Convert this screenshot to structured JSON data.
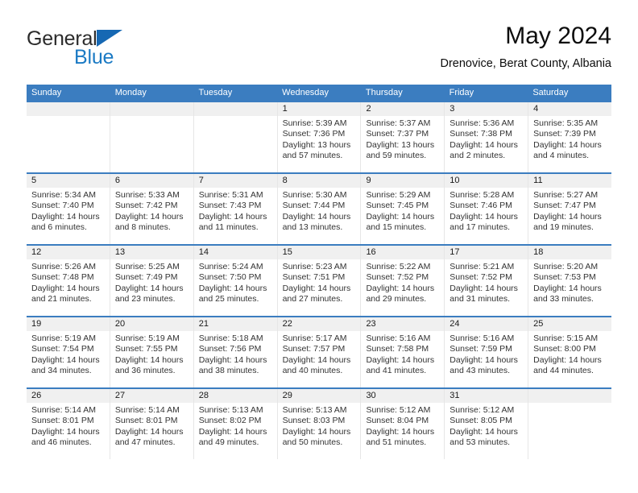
{
  "brand": {
    "name_top": "General",
    "name_bottom": "Blue",
    "accent_color": "#1668b3",
    "text_color": "#2b2b2b"
  },
  "header": {
    "title": "May 2024",
    "subtitle": "Drenovice, Berat County, Albania"
  },
  "theme": {
    "header_bg": "#3b7dc0",
    "header_text": "#ffffff",
    "day_number_bg": "#f0f0f0",
    "cell_border": "#e6e6e6",
    "week_separator": "#3b7dc0"
  },
  "weekdays": [
    "Sunday",
    "Monday",
    "Tuesday",
    "Wednesday",
    "Thursday",
    "Friday",
    "Saturday"
  ],
  "weeks": [
    [
      {
        "day": "",
        "sunrise": "",
        "sunset": "",
        "daylight": ""
      },
      {
        "day": "",
        "sunrise": "",
        "sunset": "",
        "daylight": ""
      },
      {
        "day": "",
        "sunrise": "",
        "sunset": "",
        "daylight": ""
      },
      {
        "day": "1",
        "sunrise": "Sunrise: 5:39 AM",
        "sunset": "Sunset: 7:36 PM",
        "daylight": "Daylight: 13 hours and 57 minutes."
      },
      {
        "day": "2",
        "sunrise": "Sunrise: 5:37 AM",
        "sunset": "Sunset: 7:37 PM",
        "daylight": "Daylight: 13 hours and 59 minutes."
      },
      {
        "day": "3",
        "sunrise": "Sunrise: 5:36 AM",
        "sunset": "Sunset: 7:38 PM",
        "daylight": "Daylight: 14 hours and 2 minutes."
      },
      {
        "day": "4",
        "sunrise": "Sunrise: 5:35 AM",
        "sunset": "Sunset: 7:39 PM",
        "daylight": "Daylight: 14 hours and 4 minutes."
      }
    ],
    [
      {
        "day": "5",
        "sunrise": "Sunrise: 5:34 AM",
        "sunset": "Sunset: 7:40 PM",
        "daylight": "Daylight: 14 hours and 6 minutes."
      },
      {
        "day": "6",
        "sunrise": "Sunrise: 5:33 AM",
        "sunset": "Sunset: 7:42 PM",
        "daylight": "Daylight: 14 hours and 8 minutes."
      },
      {
        "day": "7",
        "sunrise": "Sunrise: 5:31 AM",
        "sunset": "Sunset: 7:43 PM",
        "daylight": "Daylight: 14 hours and 11 minutes."
      },
      {
        "day": "8",
        "sunrise": "Sunrise: 5:30 AM",
        "sunset": "Sunset: 7:44 PM",
        "daylight": "Daylight: 14 hours and 13 minutes."
      },
      {
        "day": "9",
        "sunrise": "Sunrise: 5:29 AM",
        "sunset": "Sunset: 7:45 PM",
        "daylight": "Daylight: 14 hours and 15 minutes."
      },
      {
        "day": "10",
        "sunrise": "Sunrise: 5:28 AM",
        "sunset": "Sunset: 7:46 PM",
        "daylight": "Daylight: 14 hours and 17 minutes."
      },
      {
        "day": "11",
        "sunrise": "Sunrise: 5:27 AM",
        "sunset": "Sunset: 7:47 PM",
        "daylight": "Daylight: 14 hours and 19 minutes."
      }
    ],
    [
      {
        "day": "12",
        "sunrise": "Sunrise: 5:26 AM",
        "sunset": "Sunset: 7:48 PM",
        "daylight": "Daylight: 14 hours and 21 minutes."
      },
      {
        "day": "13",
        "sunrise": "Sunrise: 5:25 AM",
        "sunset": "Sunset: 7:49 PM",
        "daylight": "Daylight: 14 hours and 23 minutes."
      },
      {
        "day": "14",
        "sunrise": "Sunrise: 5:24 AM",
        "sunset": "Sunset: 7:50 PM",
        "daylight": "Daylight: 14 hours and 25 minutes."
      },
      {
        "day": "15",
        "sunrise": "Sunrise: 5:23 AM",
        "sunset": "Sunset: 7:51 PM",
        "daylight": "Daylight: 14 hours and 27 minutes."
      },
      {
        "day": "16",
        "sunrise": "Sunrise: 5:22 AM",
        "sunset": "Sunset: 7:52 PM",
        "daylight": "Daylight: 14 hours and 29 minutes."
      },
      {
        "day": "17",
        "sunrise": "Sunrise: 5:21 AM",
        "sunset": "Sunset: 7:52 PM",
        "daylight": "Daylight: 14 hours and 31 minutes."
      },
      {
        "day": "18",
        "sunrise": "Sunrise: 5:20 AM",
        "sunset": "Sunset: 7:53 PM",
        "daylight": "Daylight: 14 hours and 33 minutes."
      }
    ],
    [
      {
        "day": "19",
        "sunrise": "Sunrise: 5:19 AM",
        "sunset": "Sunset: 7:54 PM",
        "daylight": "Daylight: 14 hours and 34 minutes."
      },
      {
        "day": "20",
        "sunrise": "Sunrise: 5:19 AM",
        "sunset": "Sunset: 7:55 PM",
        "daylight": "Daylight: 14 hours and 36 minutes."
      },
      {
        "day": "21",
        "sunrise": "Sunrise: 5:18 AM",
        "sunset": "Sunset: 7:56 PM",
        "daylight": "Daylight: 14 hours and 38 minutes."
      },
      {
        "day": "22",
        "sunrise": "Sunrise: 5:17 AM",
        "sunset": "Sunset: 7:57 PM",
        "daylight": "Daylight: 14 hours and 40 minutes."
      },
      {
        "day": "23",
        "sunrise": "Sunrise: 5:16 AM",
        "sunset": "Sunset: 7:58 PM",
        "daylight": "Daylight: 14 hours and 41 minutes."
      },
      {
        "day": "24",
        "sunrise": "Sunrise: 5:16 AM",
        "sunset": "Sunset: 7:59 PM",
        "daylight": "Daylight: 14 hours and 43 minutes."
      },
      {
        "day": "25",
        "sunrise": "Sunrise: 5:15 AM",
        "sunset": "Sunset: 8:00 PM",
        "daylight": "Daylight: 14 hours and 44 minutes."
      }
    ],
    [
      {
        "day": "26",
        "sunrise": "Sunrise: 5:14 AM",
        "sunset": "Sunset: 8:01 PM",
        "daylight": "Daylight: 14 hours and 46 minutes."
      },
      {
        "day": "27",
        "sunrise": "Sunrise: 5:14 AM",
        "sunset": "Sunset: 8:01 PM",
        "daylight": "Daylight: 14 hours and 47 minutes."
      },
      {
        "day": "28",
        "sunrise": "Sunrise: 5:13 AM",
        "sunset": "Sunset: 8:02 PM",
        "daylight": "Daylight: 14 hours and 49 minutes."
      },
      {
        "day": "29",
        "sunrise": "Sunrise: 5:13 AM",
        "sunset": "Sunset: 8:03 PM",
        "daylight": "Daylight: 14 hours and 50 minutes."
      },
      {
        "day": "30",
        "sunrise": "Sunrise: 5:12 AM",
        "sunset": "Sunset: 8:04 PM",
        "daylight": "Daylight: 14 hours and 51 minutes."
      },
      {
        "day": "31",
        "sunrise": "Sunrise: 5:12 AM",
        "sunset": "Sunset: 8:05 PM",
        "daylight": "Daylight: 14 hours and 53 minutes."
      },
      {
        "day": "",
        "sunrise": "",
        "sunset": "",
        "daylight": ""
      }
    ]
  ]
}
